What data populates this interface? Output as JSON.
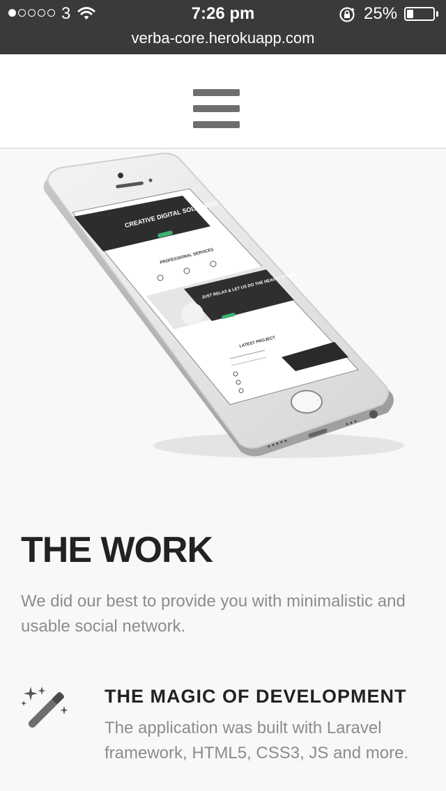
{
  "status_bar": {
    "carrier": "3",
    "time": "7:26 pm",
    "battery_percent": "25%",
    "battery_level": 0.25,
    "signal_bars_filled": 1,
    "signal_bars_total": 5,
    "url": "verba-core.herokuapp.com"
  },
  "header": {
    "menu_icon": "hamburger-icon"
  },
  "hero": {
    "mockup": {
      "hero_title": "CREATIVE DIGITAL SOLUTIONS",
      "services_title": "PROFESSIONAL SERVICES",
      "banner_title": "JUST RELAX & LET US DO THE HEAVY LIFTING",
      "latest_title": "LATEST PROJECT"
    }
  },
  "work": {
    "title": "THE WORK",
    "description": "We did our best to provide you with minimalistic and usable social network."
  },
  "feature": {
    "icon": "magic-wand-icon",
    "title": "THE MAGIC OF DEVELOPMENT",
    "description": "The application was built with Laravel framework, HTML5, CSS3, JS and more."
  },
  "colors": {
    "status_bar_bg": "#3a3a3a",
    "page_bg": "#f8f8f8",
    "heading": "#222222",
    "body_text": "#8c8c8c",
    "icon": "#6e6e6e"
  }
}
